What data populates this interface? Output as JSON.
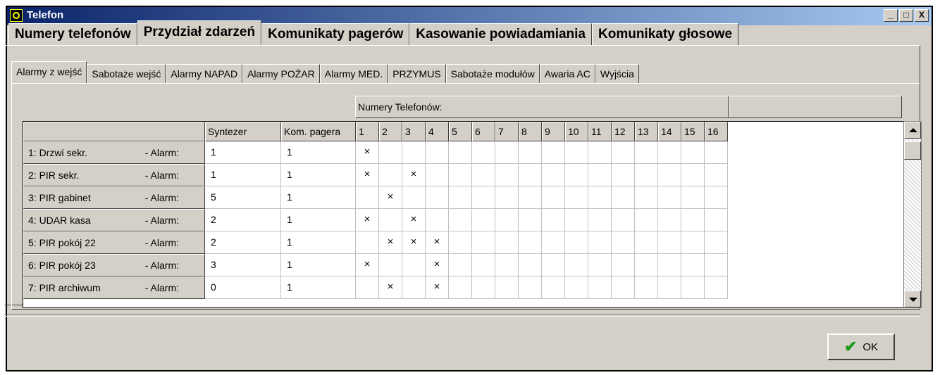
{
  "window": {
    "title": "Telefon",
    "buttons": [
      "_",
      "□",
      "X"
    ]
  },
  "main_tabs": [
    {
      "label": "Numery telefonów",
      "active": false
    },
    {
      "label": "Przydział zdarzeń",
      "active": true
    },
    {
      "label": "Komunikaty pagerów",
      "active": false
    },
    {
      "label": "Kasowanie powiadamiania",
      "active": false
    },
    {
      "label": "Komunikaty głosowe",
      "active": false
    }
  ],
  "sub_tabs": [
    {
      "label": "Alarmy z wejść",
      "active": true
    },
    {
      "label": "Sabotaże wejść",
      "active": false
    },
    {
      "label": "Alarmy NAPAD",
      "active": false
    },
    {
      "label": "Alarmy POŻAR",
      "active": false
    },
    {
      "label": "Alarmy MED.",
      "active": false
    },
    {
      "label": "PRZYMUS",
      "active": false
    },
    {
      "label": "Sabotaże modułów",
      "active": false
    },
    {
      "label": "Awaria AC",
      "active": false
    },
    {
      "label": "Wyjścia",
      "active": false
    }
  ],
  "grid": {
    "group_header": "Numery Telefonów:",
    "col_syntezer": "Syntezer",
    "col_pager": "Kom. pagera",
    "phone_cols": [
      "1",
      "2",
      "3",
      "4",
      "5",
      "6",
      "7",
      "8",
      "9",
      "10",
      "11",
      "12",
      "13",
      "14",
      "15",
      "16"
    ],
    "mark": "×",
    "rows": [
      {
        "name": "1: Drzwi sekr.",
        "suffix": "- Alarm:",
        "syntezer": "1",
        "pager": "1",
        "phones": [
          1
        ]
      },
      {
        "name": "2: PIR sekr.",
        "suffix": "- Alarm:",
        "syntezer": "1",
        "pager": "1",
        "phones": [
          1,
          3
        ]
      },
      {
        "name": "3: PIR gabinet",
        "suffix": "- Alarm:",
        "syntezer": "5",
        "pager": "1",
        "phones": [
          2
        ]
      },
      {
        "name": "4: UDAR kasa",
        "suffix": "- Alarm:",
        "syntezer": "2",
        "pager": "1",
        "phones": [
          1,
          3
        ]
      },
      {
        "name": "5: PIR pokój 22",
        "suffix": "- Alarm:",
        "syntezer": "2",
        "pager": "1",
        "phones": [
          2,
          3,
          4
        ]
      },
      {
        "name": "6: PIR pokój 23",
        "suffix": "- Alarm:",
        "syntezer": "3",
        "pager": "1",
        "phones": [
          1,
          4
        ]
      },
      {
        "name": "7: PIR archiwum",
        "suffix": "- Alarm:",
        "syntezer": "0",
        "pager": "1",
        "phones": [
          2,
          4
        ]
      }
    ]
  },
  "ok_button": {
    "label": "OK",
    "icon": "check-icon"
  }
}
